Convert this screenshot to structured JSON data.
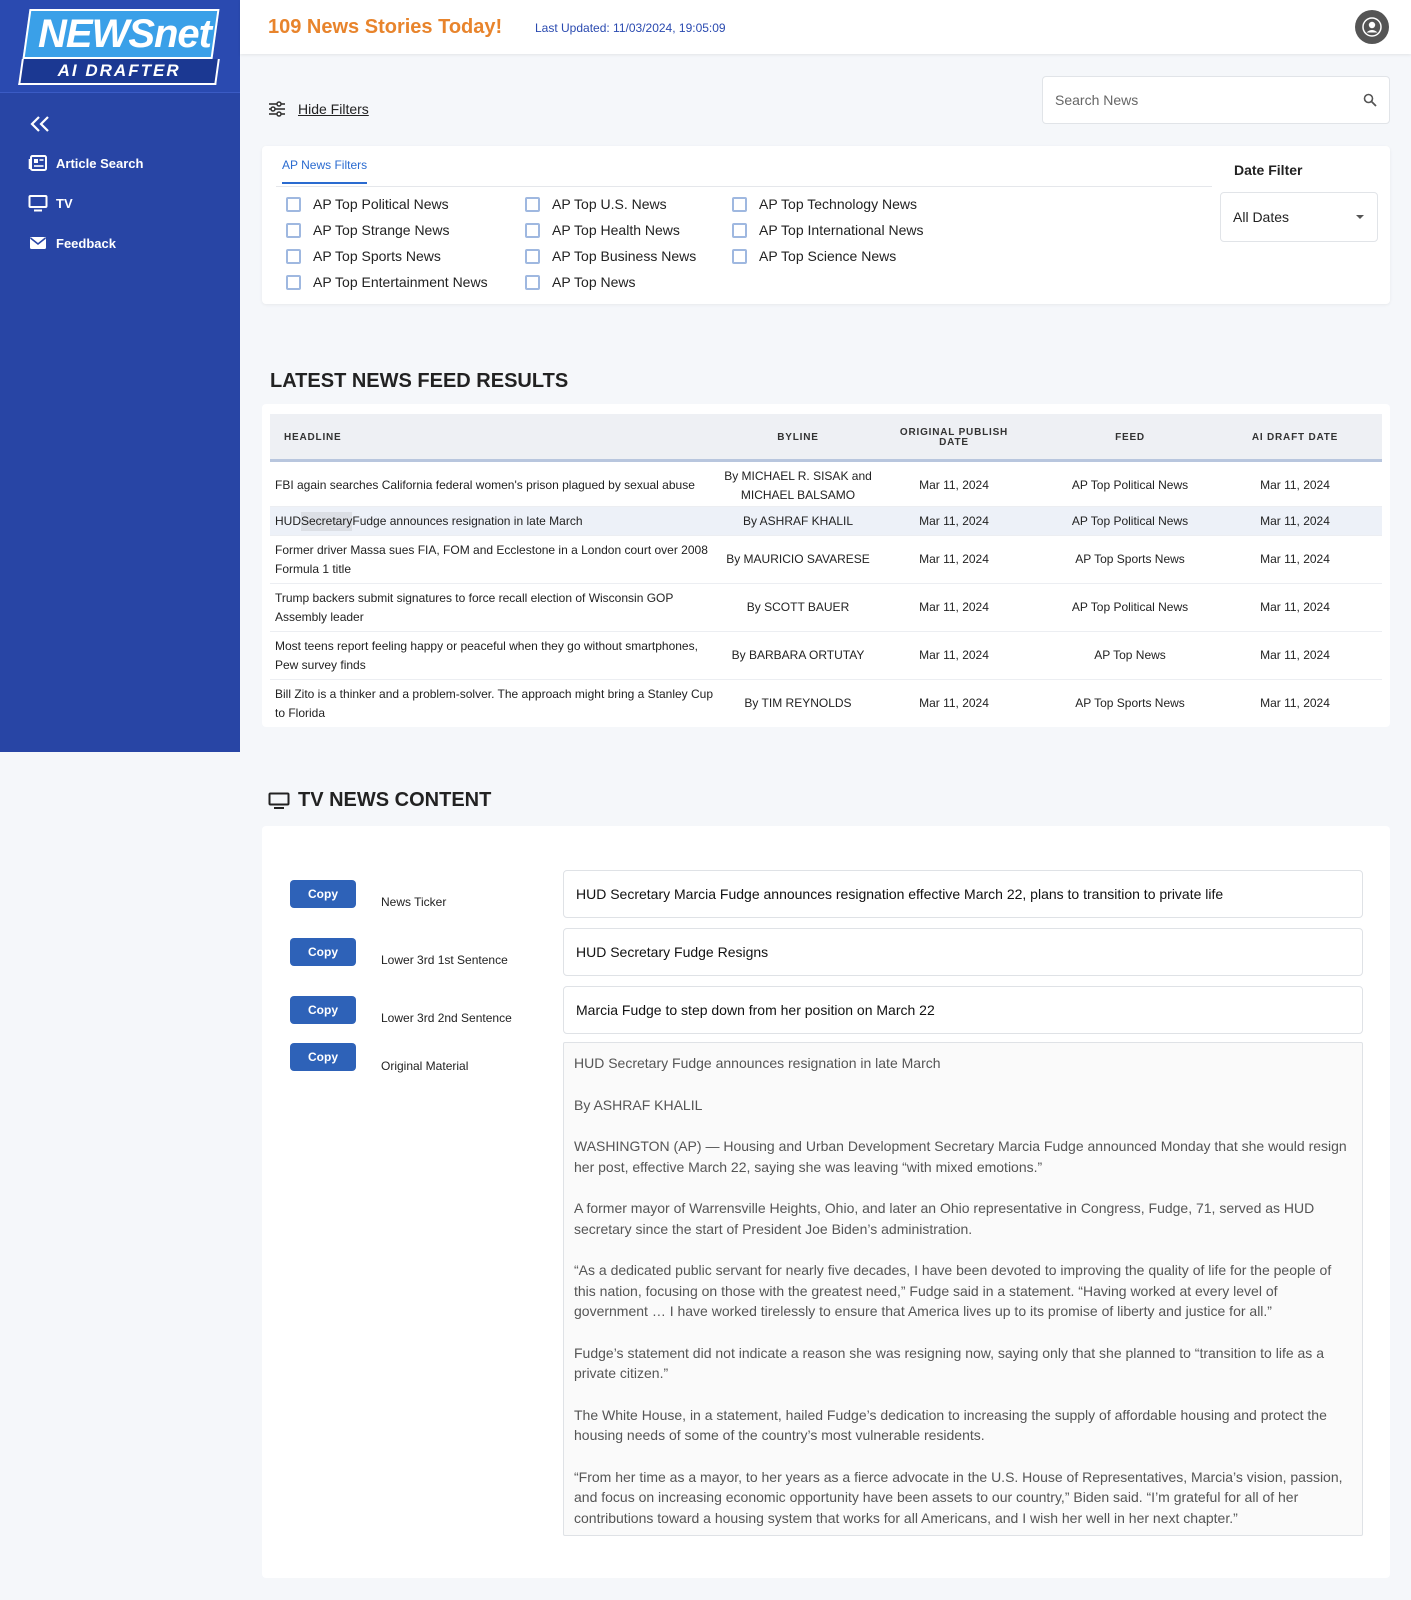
{
  "brand": {
    "logo_top": "NEWSnet",
    "logo_bottom": "AI DRAFTER"
  },
  "sidebar": {
    "items": [
      {
        "label": "Article Search",
        "icon": "newspaper-icon"
      },
      {
        "label": "TV",
        "icon": "monitor-icon"
      },
      {
        "label": "Feedback",
        "icon": "envelope-icon"
      }
    ]
  },
  "header": {
    "count_text": "109 News Stories Today!",
    "updated_text": "Last Updated: 11/03/2024, 19:05:09"
  },
  "filters": {
    "toggle_label": "Hide Filters",
    "search_placeholder": "Search News",
    "tab_label": "AP News Filters",
    "options": [
      "AP Top Political News",
      "AP Top Strange News",
      "AP Top Sports News",
      "AP Top Entertainment News",
      "AP Top U.S. News",
      "AP Top Health News",
      "AP Top Business News",
      "AP Top News",
      "AP Top Technology News",
      "AP Top International News",
      "AP Top Science News"
    ],
    "date_label": "Date Filter",
    "date_value": "All Dates"
  },
  "results": {
    "title": "LATEST NEWS FEED RESULTS",
    "columns": {
      "headline": "HEADLINE",
      "byline": "BYLINE",
      "publish_1": "ORIGINAL PUBLISH",
      "publish_2": "DATE",
      "feed": "FEED",
      "ai": "AI DRAFT DATE"
    },
    "rows": [
      {
        "headline": "FBI again searches California federal women's prison plagued by sexual abuse",
        "byline": "By MICHAEL R. SISAK and MICHAEL BALSAMO",
        "date": "Mar 11, 2024",
        "feed": "AP Top Political News",
        "ai": "Mar 11, 2024"
      },
      {
        "headline_pre": "HUD ",
        "headline_hl": "Secretary",
        "headline_post": " Fudge announces resignation in late March",
        "byline": "By ASHRAF KHALIL",
        "date": "Mar 11, 2024",
        "feed": "AP Top Political News",
        "ai": "Mar 11, 2024"
      },
      {
        "headline": "Former driver Massa sues FIA, FOM and Ecclestone in a London court over 2008 Formula 1 title",
        "byline": "By MAURICIO SAVARESE",
        "date": "Mar 11, 2024",
        "feed": "AP Top Sports News",
        "ai": "Mar 11, 2024"
      },
      {
        "headline": "Trump backers submit signatures to force recall election of Wisconsin GOP Assembly leader",
        "byline": "By SCOTT BAUER",
        "date": "Mar 11, 2024",
        "feed": "AP Top Political News",
        "ai": "Mar 11, 2024"
      },
      {
        "headline": "Most teens report feeling happy or peaceful when they go without smartphones, Pew survey finds",
        "byline": "By BARBARA ORTUTAY",
        "date": "Mar 11, 2024",
        "feed": "AP Top News",
        "ai": "Mar 11, 2024"
      },
      {
        "headline": "Bill Zito is a thinker and a problem-solver. The approach might bring a Stanley Cup to Florida",
        "byline": "By TIM REYNOLDS",
        "date": "Mar 11, 2024",
        "feed": "AP Top Sports News",
        "ai": "Mar 11, 2024"
      }
    ]
  },
  "tv": {
    "title": "TV NEWS CONTENT",
    "copy_label": "Copy",
    "items": [
      {
        "label": "News Ticker",
        "value": "HUD Secretary Marcia Fudge announces resignation effective March 22, plans to transition to private life"
      },
      {
        "label": "Lower 3rd 1st Sentence",
        "value": "HUD Secretary Fudge Resigns"
      },
      {
        "label": "Lower 3rd 2nd Sentence",
        "value": "Marcia Fudge to step down from her position on March 22"
      }
    ],
    "original_label": "Original Material",
    "original_paragraphs": [
      "HUD Secretary Fudge announces resignation in late March",
      "By ASHRAF KHALIL",
      "WASHINGTON (AP) — Housing and Urban Development Secretary Marcia Fudge announced Monday that she would resign her post, effective March 22, saying she was leaving “with mixed emotions.”",
      "A former mayor of Warrensville Heights, Ohio, and later an Ohio representative in Congress, Fudge, 71, served as HUD secretary since the start of President Joe Biden’s administration.",
      "“As a dedicated public servant for nearly five decades, I have been devoted to improving the quality of life for the people of this nation, focusing on those with the greatest need,” Fudge said in a statement. “Having worked at every level of government … I have worked tirelessly to ensure that America lives up to its promise of liberty and justice for all.”",
      "Fudge’s statement did not indicate a reason she was resigning now, saying only that she planned to “transition to life as a private citizen.”",
      "The White House, in a statement, hailed Fudge’s dedication to increasing the supply of affordable housing and protect the housing needs of some of the country’s most vulnerable residents.",
      "“From her time as a mayor, to her years as a fierce advocate in the U.S. House of Representatives, Marcia’s vision, passion, and focus on increasing economic opportunity have been assets to our country,” Biden said. “I’m grateful for all of her contributions toward a housing system that works for all Americans, and I wish her well in her next chapter.”"
    ]
  },
  "colors": {
    "sidebar": "#2845a5",
    "accent_orange": "#e8842c",
    "button_blue": "#2e62b8"
  }
}
